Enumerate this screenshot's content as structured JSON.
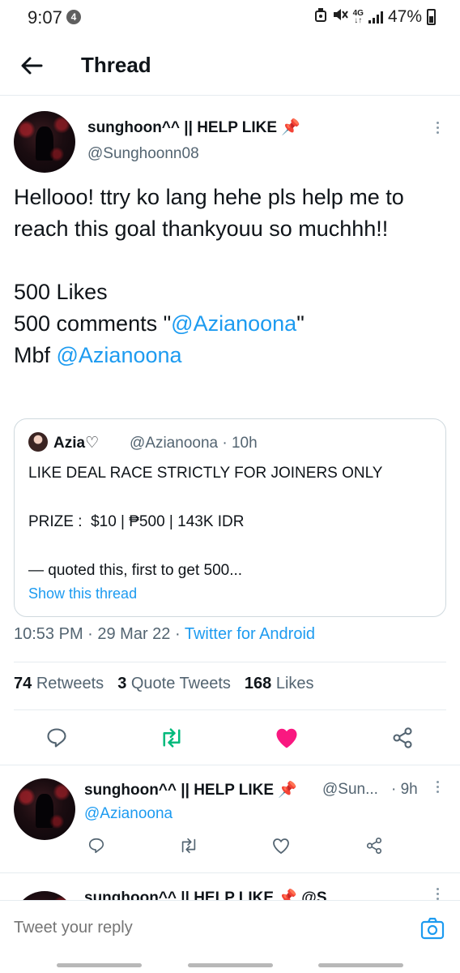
{
  "status_bar": {
    "time": "9:07",
    "notification_count": "4",
    "network": "4G",
    "battery": "47%"
  },
  "header": {
    "title": "Thread"
  },
  "main_tweet": {
    "display_name": "sunghoon^^ || HELP LIKE",
    "pin_emoji": "📌",
    "handle": "@Sunghoonn08",
    "text_lines": {
      "line1": "Hellooo! ttry ko lang hehe pls help me to reach this goal thankyouu so muchhh!!",
      "line2": "500 Likes",
      "line3_prefix": "500 comments \"",
      "line3_mention": "@Azianoona",
      "line3_suffix": "\"",
      "line4_prefix": "Mbf ",
      "line4_mention": "@Azianoona"
    },
    "quoted": {
      "display_name": "Azia♡",
      "meta": "@Azianoona · 10h",
      "text": "LIKE DEAL RACE STRICTLY FOR JOINERS ONLY\n\nPRIZE :  $10 | ₱500 | 143K IDR\n\n— quoted this, first to get 500...",
      "show_thread": "Show this thread"
    },
    "timestamp": "10:53 PM · 29 Mar 22 · ",
    "source": "Twitter for Android",
    "stats": {
      "retweets_count": "74",
      "retweets_label": "Retweets",
      "quotes_count": "3",
      "quotes_label": "Quote Tweets",
      "likes_count": "168",
      "likes_label": "Likes"
    },
    "liked": true,
    "accent_color": "#1d9bf0",
    "retweet_color": "#00ba7c",
    "like_color": "#f91880"
  },
  "reply": {
    "display_name": "sunghoon^^ || HELP LIKE",
    "pin_emoji": "📌",
    "handle": "@Sun...",
    "time": "· 9h",
    "mention": "@Azianoona"
  },
  "next_reply_peek": {
    "display_name": "sunghoon^^ || HELP LIKE 📌 @S..."
  },
  "compose": {
    "placeholder": "Tweet your reply"
  }
}
